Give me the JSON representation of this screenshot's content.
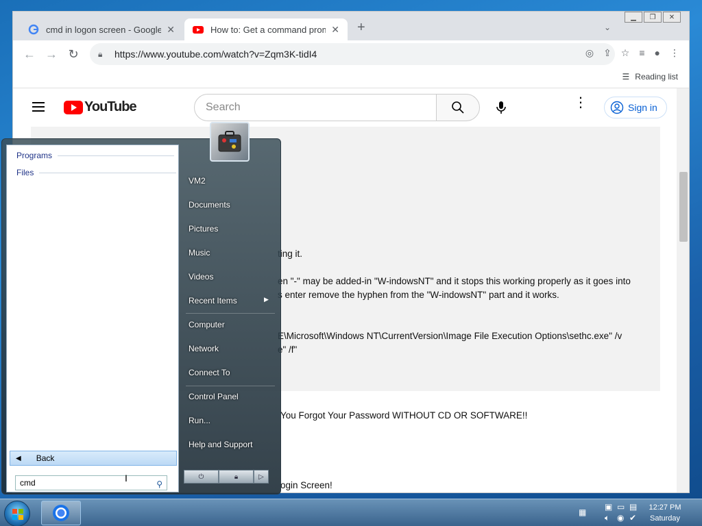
{
  "desktop": {
    "background_color": "#1f79c4"
  },
  "browser": {
    "tabs": [
      {
        "title": "cmd in logon screen - Google Se",
        "favicon": "google-icon",
        "active": false
      },
      {
        "title": "How to: Get a command prompt",
        "favicon": "youtube-icon",
        "active": true
      }
    ],
    "new_tab": "+",
    "url": "https://www.youtube.com/watch?v=Zqm3K-tidI4",
    "reading_list": "Reading list"
  },
  "youtube": {
    "logo_text": "YouTube",
    "search_placeholder": "Search",
    "sign_in": "Sign in",
    "description_lines": [
      "ting it.",
      "en \"-\" may be added-in \"W-indowsNT\" and it stops this working properly as it goes into",
      "s enter remove the hyphen from the \"W-indowsNT\" part and it works.",
      "E\\Microsoft\\Windows NT\\CurrentVersion\\Image File Execution Options\\sethc.exe\" /v",
      "e\" /f\""
    ],
    "related": [
      "You Forgot Your Password WITHOUT CD OR SOFTWARE!!",
      "ogin Screen!"
    ]
  },
  "start_menu": {
    "categories": [
      "Programs",
      "Files"
    ],
    "back_label": "Back",
    "search_value": "cmd",
    "right_items": [
      "VM2",
      "Documents",
      "Pictures",
      "Music",
      "Videos",
      "Recent Items",
      "Computer",
      "Network",
      "Connect To",
      "Control Panel",
      "Run...",
      "Help and Support"
    ]
  },
  "taskbar": {
    "clock_time": "12:27 PM",
    "clock_day": "Saturday"
  }
}
